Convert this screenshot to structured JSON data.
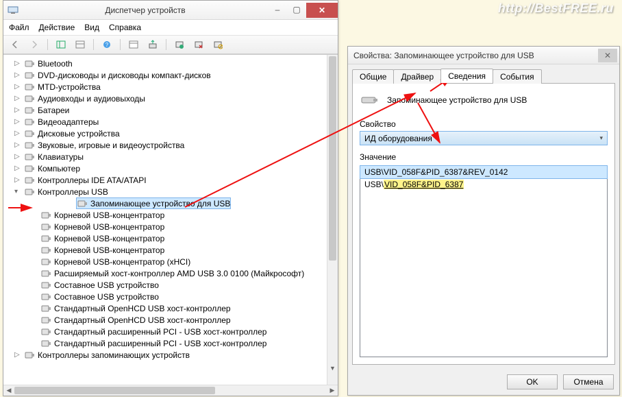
{
  "watermark": "http://BestFREE.ru",
  "dm": {
    "title": "Диспетчер устройств",
    "menu": {
      "file": "Файл",
      "action": "Действие",
      "view": "Вид",
      "help": "Справка"
    },
    "tree": [
      {
        "label": "Bluetooth",
        "lvl": 1,
        "arrow": "▷"
      },
      {
        "label": "DVD-дисководы и дисководы компакт-дисков",
        "lvl": 1,
        "arrow": "▷"
      },
      {
        "label": "MTD-устройства",
        "lvl": 1,
        "arrow": "▷"
      },
      {
        "label": "Аудиовходы и аудиовыходы",
        "lvl": 1,
        "arrow": "▷"
      },
      {
        "label": "Батареи",
        "lvl": 1,
        "arrow": "▷"
      },
      {
        "label": "Видеоадаптеры",
        "lvl": 1,
        "arrow": "▷"
      },
      {
        "label": "Дисковые устройства",
        "lvl": 1,
        "arrow": "▷"
      },
      {
        "label": "Звуковые, игровые и видеоустройства",
        "lvl": 1,
        "arrow": "▷"
      },
      {
        "label": "Клавиатуры",
        "lvl": 1,
        "arrow": "▷"
      },
      {
        "label": "Компьютер",
        "lvl": 1,
        "arrow": "▷"
      },
      {
        "label": "Контроллеры IDE ATA/ATAPI",
        "lvl": 1,
        "arrow": "▷"
      },
      {
        "label": "Контроллеры USB",
        "lvl": 1,
        "arrow": "▾",
        "expanded": true
      },
      {
        "label": "Запоминающее устройство для USB",
        "lvl": 2,
        "selected": true
      },
      {
        "label": "Корневой USB-концентратор",
        "lvl": 2
      },
      {
        "label": "Корневой USB-концентратор",
        "lvl": 2
      },
      {
        "label": "Корневой USB-концентратор",
        "lvl": 2
      },
      {
        "label": "Корневой USB-концентратор",
        "lvl": 2
      },
      {
        "label": "Корневой USB-концентратор (xHCI)",
        "lvl": 2
      },
      {
        "label": "Расширяемый хост-контроллер AMD USB 3.0 0100 (Майкрософт)",
        "lvl": 2
      },
      {
        "label": "Составное USB устройство",
        "lvl": 2
      },
      {
        "label": "Составное USB устройство",
        "lvl": 2
      },
      {
        "label": "Стандартный OpenHCD USB хост-контроллер",
        "lvl": 2
      },
      {
        "label": "Стандартный OpenHCD USB хост-контроллер",
        "lvl": 2
      },
      {
        "label": "Стандартный расширенный PCI - USB хост-контроллер",
        "lvl": 2
      },
      {
        "label": "Стандартный расширенный PCI - USB хост-контроллер",
        "lvl": 2
      },
      {
        "label": "Контроллеры запоминающих устройств",
        "lvl": 1,
        "arrow": "▷"
      }
    ]
  },
  "props": {
    "title": "Свойства: Запоминающее устройство для USB",
    "tabs": {
      "general": "Общие",
      "driver": "Драйвер",
      "details": "Сведения",
      "events": "События"
    },
    "device_name": "Запоминающее устройство для USB",
    "property_label": "Свойство",
    "property_value": "ИД оборудования",
    "values_label": "Значение",
    "values": {
      "row1": "USB\\VID_058F&PID_6387&REV_0142",
      "row2_prefix": "USB\\",
      "row2_highlight": "VID_058F&PID_6387"
    },
    "ok": "OK",
    "cancel": "Отмена"
  }
}
